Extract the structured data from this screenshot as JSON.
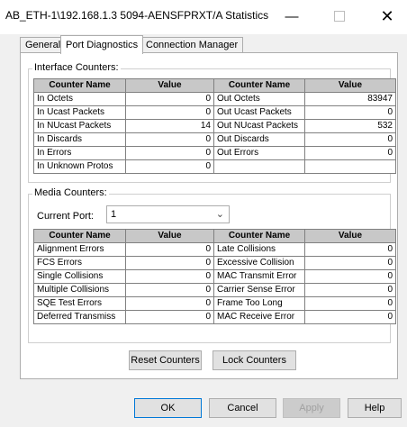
{
  "window": {
    "title": "AB_ETH-1\\192.168.1.3 5094-AENSFPRXT/A Statistics",
    "minimize_glyph": "—",
    "close_glyph": "✕"
  },
  "tabs": [
    {
      "label": "General",
      "active": false
    },
    {
      "label": "Port Diagnostics",
      "active": true
    },
    {
      "label": "Connection Manager",
      "active": false
    }
  ],
  "interface_counters": {
    "label": "Interface Counters:",
    "headers": [
      "Counter Name",
      "Value",
      "Counter Name",
      "Value"
    ],
    "rows": [
      [
        "In Octets",
        "0",
        "Out Octets",
        "83947"
      ],
      [
        "In Ucast Packets",
        "0",
        "Out Ucast Packets",
        "0"
      ],
      [
        "In NUcast Packets",
        "14",
        "Out NUcast Packets",
        "532"
      ],
      [
        "In Discards",
        "0",
        "Out Discards",
        "0"
      ],
      [
        "In Errors",
        "0",
        "Out Errors",
        "0"
      ],
      [
        "In Unknown Protos",
        "0",
        "",
        ""
      ]
    ]
  },
  "media_counters": {
    "label": "Media Counters:",
    "current_port_label": "Current Port:",
    "current_port_value": "1",
    "headers": [
      "Counter Name",
      "Value",
      "Counter Name",
      "Value"
    ],
    "rows": [
      [
        "Alignment Errors",
        "0",
        "Late Collisions",
        "0"
      ],
      [
        "FCS Errors",
        "0",
        "Excessive Collision",
        "0"
      ],
      [
        "Single Collisions",
        "0",
        "MAC Transmit Error",
        "0"
      ],
      [
        "Multiple Collisions",
        "0",
        "Carrier Sense Error",
        "0"
      ],
      [
        "SQE Test Errors",
        "0",
        "Frame Too Long",
        "0"
      ],
      [
        "Deferred Transmiss",
        "0",
        "MAC Receive Error",
        "0"
      ]
    ]
  },
  "actions": {
    "reset_counters": "Reset Counters",
    "lock_counters": "Lock Counters"
  },
  "footer": {
    "ok": "OK",
    "cancel": "Cancel",
    "apply": "Apply",
    "help": "Help"
  }
}
